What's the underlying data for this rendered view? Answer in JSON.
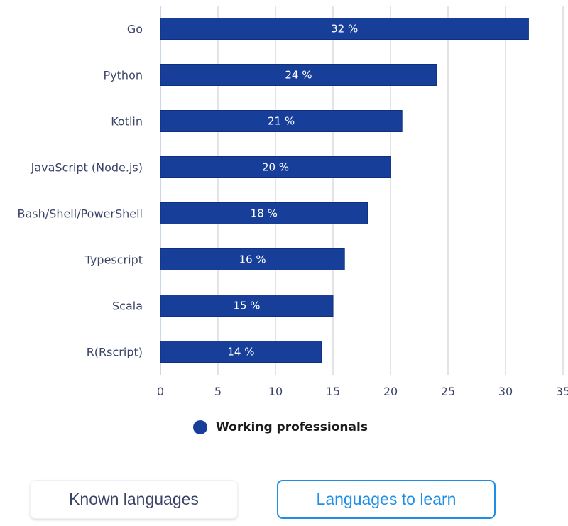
{
  "chart_data": {
    "type": "bar",
    "orientation": "horizontal",
    "title": "",
    "xlabel": "",
    "ylabel": "",
    "categories": [
      "Go",
      "Python",
      "Kotlin",
      "JavaScript (Node.js)",
      "Bash/Shell/PowerShell",
      "Typescript",
      "Scala",
      "R(Rscript)"
    ],
    "series": [
      {
        "name": "Working professionals",
        "values": [
          32,
          24,
          21,
          20,
          18,
          16,
          15,
          14
        ],
        "color": "#173f9a"
      }
    ],
    "data_labels": [
      "32 %",
      "24 %",
      "21 %",
      "20 %",
      "18 %",
      "16 %",
      "15 %",
      "14 %"
    ],
    "xlim": [
      0,
      35
    ],
    "x_ticks": [
      0,
      5,
      10,
      15,
      20,
      25,
      30,
      35
    ],
    "grid": true,
    "legend_position": "bottom"
  },
  "legend": {
    "label": "Working professionals",
    "color": "#173f9a"
  },
  "buttons": {
    "known_languages": "Known languages",
    "languages_to_learn": "Languages to learn"
  }
}
